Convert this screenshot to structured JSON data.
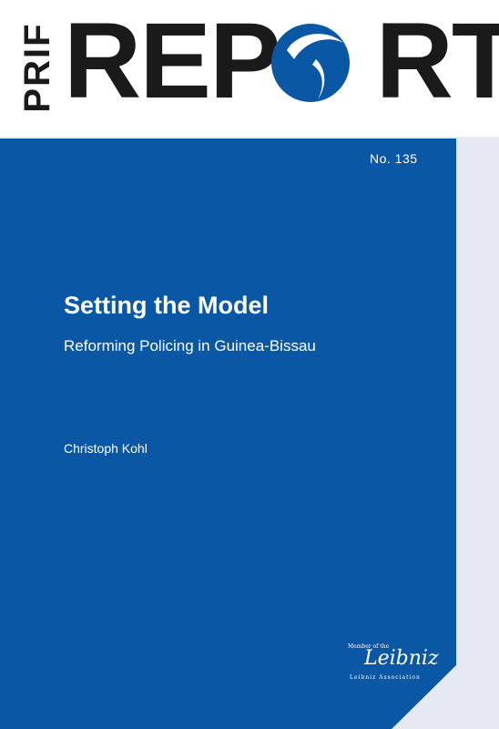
{
  "header": {
    "series_prefix": "PRIF",
    "report_letters": [
      "R",
      "E",
      "P",
      "",
      "R",
      "T"
    ]
  },
  "cover": {
    "issue_number": "No. 135",
    "title": "Setting the Model",
    "subtitle": "Reforming Policing in Guinea-Bissau",
    "author": "Christoph Kohl"
  },
  "footer": {
    "member_of": "Member of the",
    "leibniz_script": "Leibniz",
    "leibniz_association": "Leibniz Association"
  },
  "colors": {
    "brand_blue": "#0a57a6",
    "text_dark": "#1a1a1a",
    "background": "#e6e8f3"
  }
}
